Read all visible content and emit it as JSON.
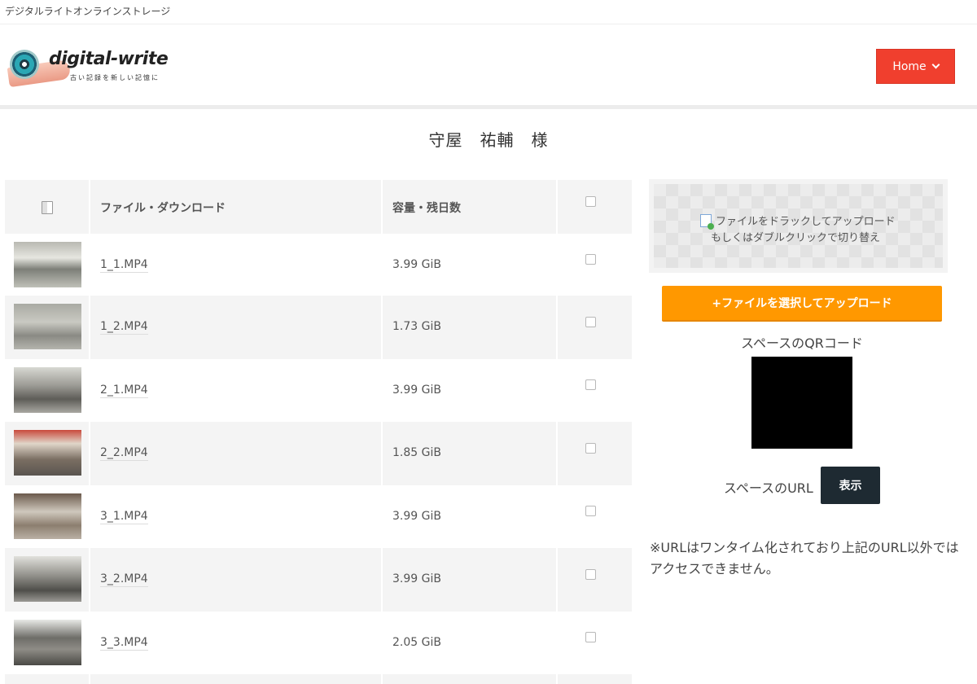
{
  "site": {
    "top_title": "デジタルライトオンラインストレージ",
    "logo_text": "digital-write",
    "logo_tagline": "古い記録を新しい記憶に",
    "nav_button": "Home"
  },
  "user": {
    "name": "守屋　祐輔　様"
  },
  "table": {
    "headers": {
      "file": "ファイル・ダウンロード",
      "size": "容量・残日数"
    },
    "rows": [
      {
        "name": "1_1.MP4",
        "size": "3.99 GiB"
      },
      {
        "name": "1_2.MP4",
        "size": "1.73 GiB"
      },
      {
        "name": "2_1.MP4",
        "size": "3.99 GiB"
      },
      {
        "name": "2_2.MP4",
        "size": "1.85 GiB"
      },
      {
        "name": "3_1.MP4",
        "size": "3.99 GiB"
      },
      {
        "name": "3_2.MP4",
        "size": "3.99 GiB"
      },
      {
        "name": "3_3.MP4",
        "size": "2.05 GiB"
      }
    ]
  },
  "upload": {
    "drop_line1": "ファイルをドラックしてアップロード",
    "drop_line2": "もしくはダブルクリックで切り替え",
    "button": "+ファイルを選択してアップロード"
  },
  "space": {
    "qr_title": "スペースのQRコード",
    "url_label": "スペースのURL",
    "url_button": "表示",
    "note": "※URLはワンタイム化されており上記のURL以外ではアクセスできません。"
  },
  "colors": {
    "home_button": "#f03f2e",
    "upload_button": "#ff9800",
    "url_button": "#1e2a32"
  }
}
